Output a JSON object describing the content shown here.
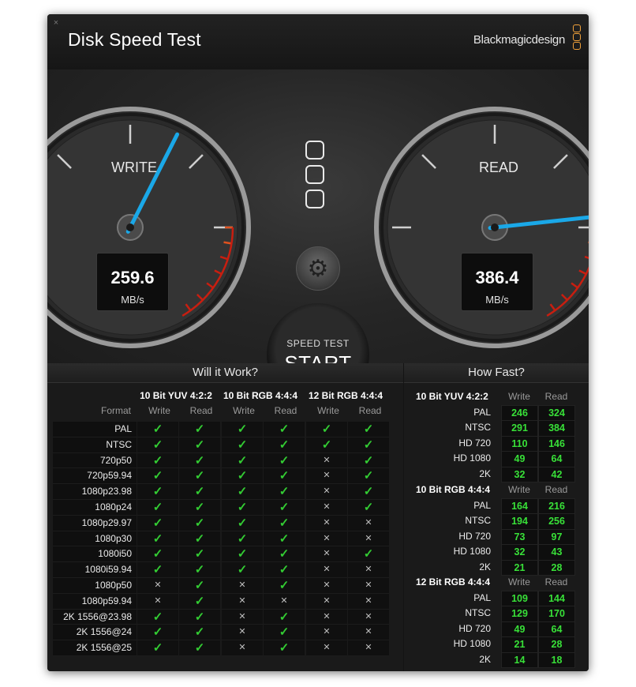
{
  "window": {
    "title": "Disk Speed Test",
    "close_glyph": "×"
  },
  "brand": {
    "text": "Blackmagicdesign",
    "logo_color": "#f2a23a"
  },
  "gauges": {
    "write": {
      "label": "WRITE",
      "value": "259.6",
      "unit": "MB/s"
    },
    "read": {
      "label": "READ",
      "value": "386.4",
      "unit": "MB/s"
    }
  },
  "center": {
    "settings_icon": "gear-icon",
    "start_small": "SPEED TEST",
    "start_big": "START"
  },
  "will_it_work": {
    "title": "Will it Work?",
    "format_header": "Format",
    "groups": [
      "10 Bit YUV 4:2:2",
      "10 Bit RGB 4:4:4",
      "12 Bit RGB 4:4:4"
    ],
    "sub_headers": [
      "Write",
      "Read",
      "Write",
      "Read",
      "Write",
      "Read"
    ],
    "ok_glyph": "✓",
    "no_glyph": "✕",
    "rows": [
      {
        "format": "PAL",
        "cells": [
          1,
          1,
          1,
          1,
          1,
          1
        ]
      },
      {
        "format": "NTSC",
        "cells": [
          1,
          1,
          1,
          1,
          1,
          1
        ]
      },
      {
        "format": "720p50",
        "cells": [
          1,
          1,
          1,
          1,
          0,
          1
        ]
      },
      {
        "format": "720p59.94",
        "cells": [
          1,
          1,
          1,
          1,
          0,
          1
        ]
      },
      {
        "format": "1080p23.98",
        "cells": [
          1,
          1,
          1,
          1,
          0,
          1
        ]
      },
      {
        "format": "1080p24",
        "cells": [
          1,
          1,
          1,
          1,
          0,
          1
        ]
      },
      {
        "format": "1080p29.97",
        "cells": [
          1,
          1,
          1,
          1,
          0,
          0
        ]
      },
      {
        "format": "1080p30",
        "cells": [
          1,
          1,
          1,
          1,
          0,
          0
        ]
      },
      {
        "format": "1080i50",
        "cells": [
          1,
          1,
          1,
          1,
          0,
          1
        ]
      },
      {
        "format": "1080i59.94",
        "cells": [
          1,
          1,
          1,
          1,
          0,
          0
        ]
      },
      {
        "format": "1080p50",
        "cells": [
          0,
          1,
          0,
          1,
          0,
          0
        ]
      },
      {
        "format": "1080p59.94",
        "cells": [
          0,
          1,
          0,
          0,
          0,
          0
        ]
      },
      {
        "format": "2K 1556@23.98",
        "cells": [
          1,
          1,
          0,
          1,
          0,
          0
        ]
      },
      {
        "format": "2K 1556@24",
        "cells": [
          1,
          1,
          0,
          1,
          0,
          0
        ]
      },
      {
        "format": "2K 1556@25",
        "cells": [
          1,
          1,
          0,
          1,
          0,
          0
        ]
      }
    ]
  },
  "how_fast": {
    "title": "How Fast?",
    "groups": [
      {
        "name": "10 Bit YUV 4:2:2",
        "write_label": "Write",
        "read_label": "Read",
        "rows": [
          {
            "label": "PAL",
            "write": "246",
            "read": "324"
          },
          {
            "label": "NTSC",
            "write": "291",
            "read": "384"
          },
          {
            "label": "HD 720",
            "write": "110",
            "read": "146"
          },
          {
            "label": "HD 1080",
            "write": "49",
            "read": "64"
          },
          {
            "label": "2K",
            "write": "32",
            "read": "42"
          }
        ]
      },
      {
        "name": "10 Bit RGB 4:4:4",
        "write_label": "Write",
        "read_label": "Read",
        "rows": [
          {
            "label": "PAL",
            "write": "164",
            "read": "216"
          },
          {
            "label": "NTSC",
            "write": "194",
            "read": "256"
          },
          {
            "label": "HD 720",
            "write": "73",
            "read": "97"
          },
          {
            "label": "HD 1080",
            "write": "32",
            "read": "43"
          },
          {
            "label": "2K",
            "write": "21",
            "read": "28"
          }
        ]
      },
      {
        "name": "12 Bit RGB 4:4:4",
        "write_label": "Write",
        "read_label": "Read",
        "rows": [
          {
            "label": "PAL",
            "write": "109",
            "read": "144"
          },
          {
            "label": "NTSC",
            "write": "129",
            "read": "170"
          },
          {
            "label": "HD 720",
            "write": "49",
            "read": "64"
          },
          {
            "label": "HD 1080",
            "write": "21",
            "read": "28"
          },
          {
            "label": "2K",
            "write": "14",
            "read": "18"
          }
        ]
      }
    ]
  }
}
